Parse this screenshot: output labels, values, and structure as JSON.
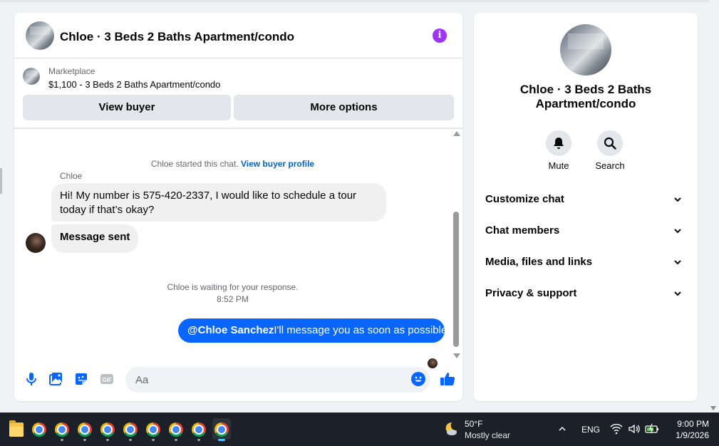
{
  "chat": {
    "title": "Chloe · 3 Beds 2 Baths Apartment/condo",
    "info_icon": "i",
    "listing": {
      "source": "Marketplace",
      "price_title": "$1,100 - 3 Beds 2 Baths Apartment/condo",
      "view_buyer_label": "View buyer",
      "more_options_label": "More options"
    },
    "started_text": "Chloe started this chat.",
    "view_profile_link": "View buyer profile",
    "sender_name": "Chloe",
    "incoming_message_1": "Hi! My number is 575-420-2337, I would like to schedule a tour today if that’s okay?",
    "incoming_message_2": "Message sent",
    "waiting_text": "Chloe is waiting for your response.",
    "timestamp": "8:52 PM",
    "outgoing_mention": "@Chloe Sanchez",
    "outgoing_text": "I'll message you as soon as possible",
    "composer_placeholder": "Aa",
    "composer_gif": "GIF"
  },
  "info_panel": {
    "title": "Chloe · 3 Beds 2 Baths Apartment/condo",
    "mute_label": "Mute",
    "search_label": "Search",
    "sections": [
      {
        "label": "Customize chat"
      },
      {
        "label": "Chat members"
      },
      {
        "label": "Media, files and links"
      },
      {
        "label": "Privacy & support"
      }
    ]
  },
  "taskbar": {
    "weather_temp": "50°F",
    "weather_desc": "Mostly clear",
    "language": "ENG",
    "time": "9:00 PM",
    "date": "1/9/2026"
  },
  "colors": {
    "accent": "#0866ff",
    "info": "#a033ff",
    "link": "#0064d1"
  }
}
